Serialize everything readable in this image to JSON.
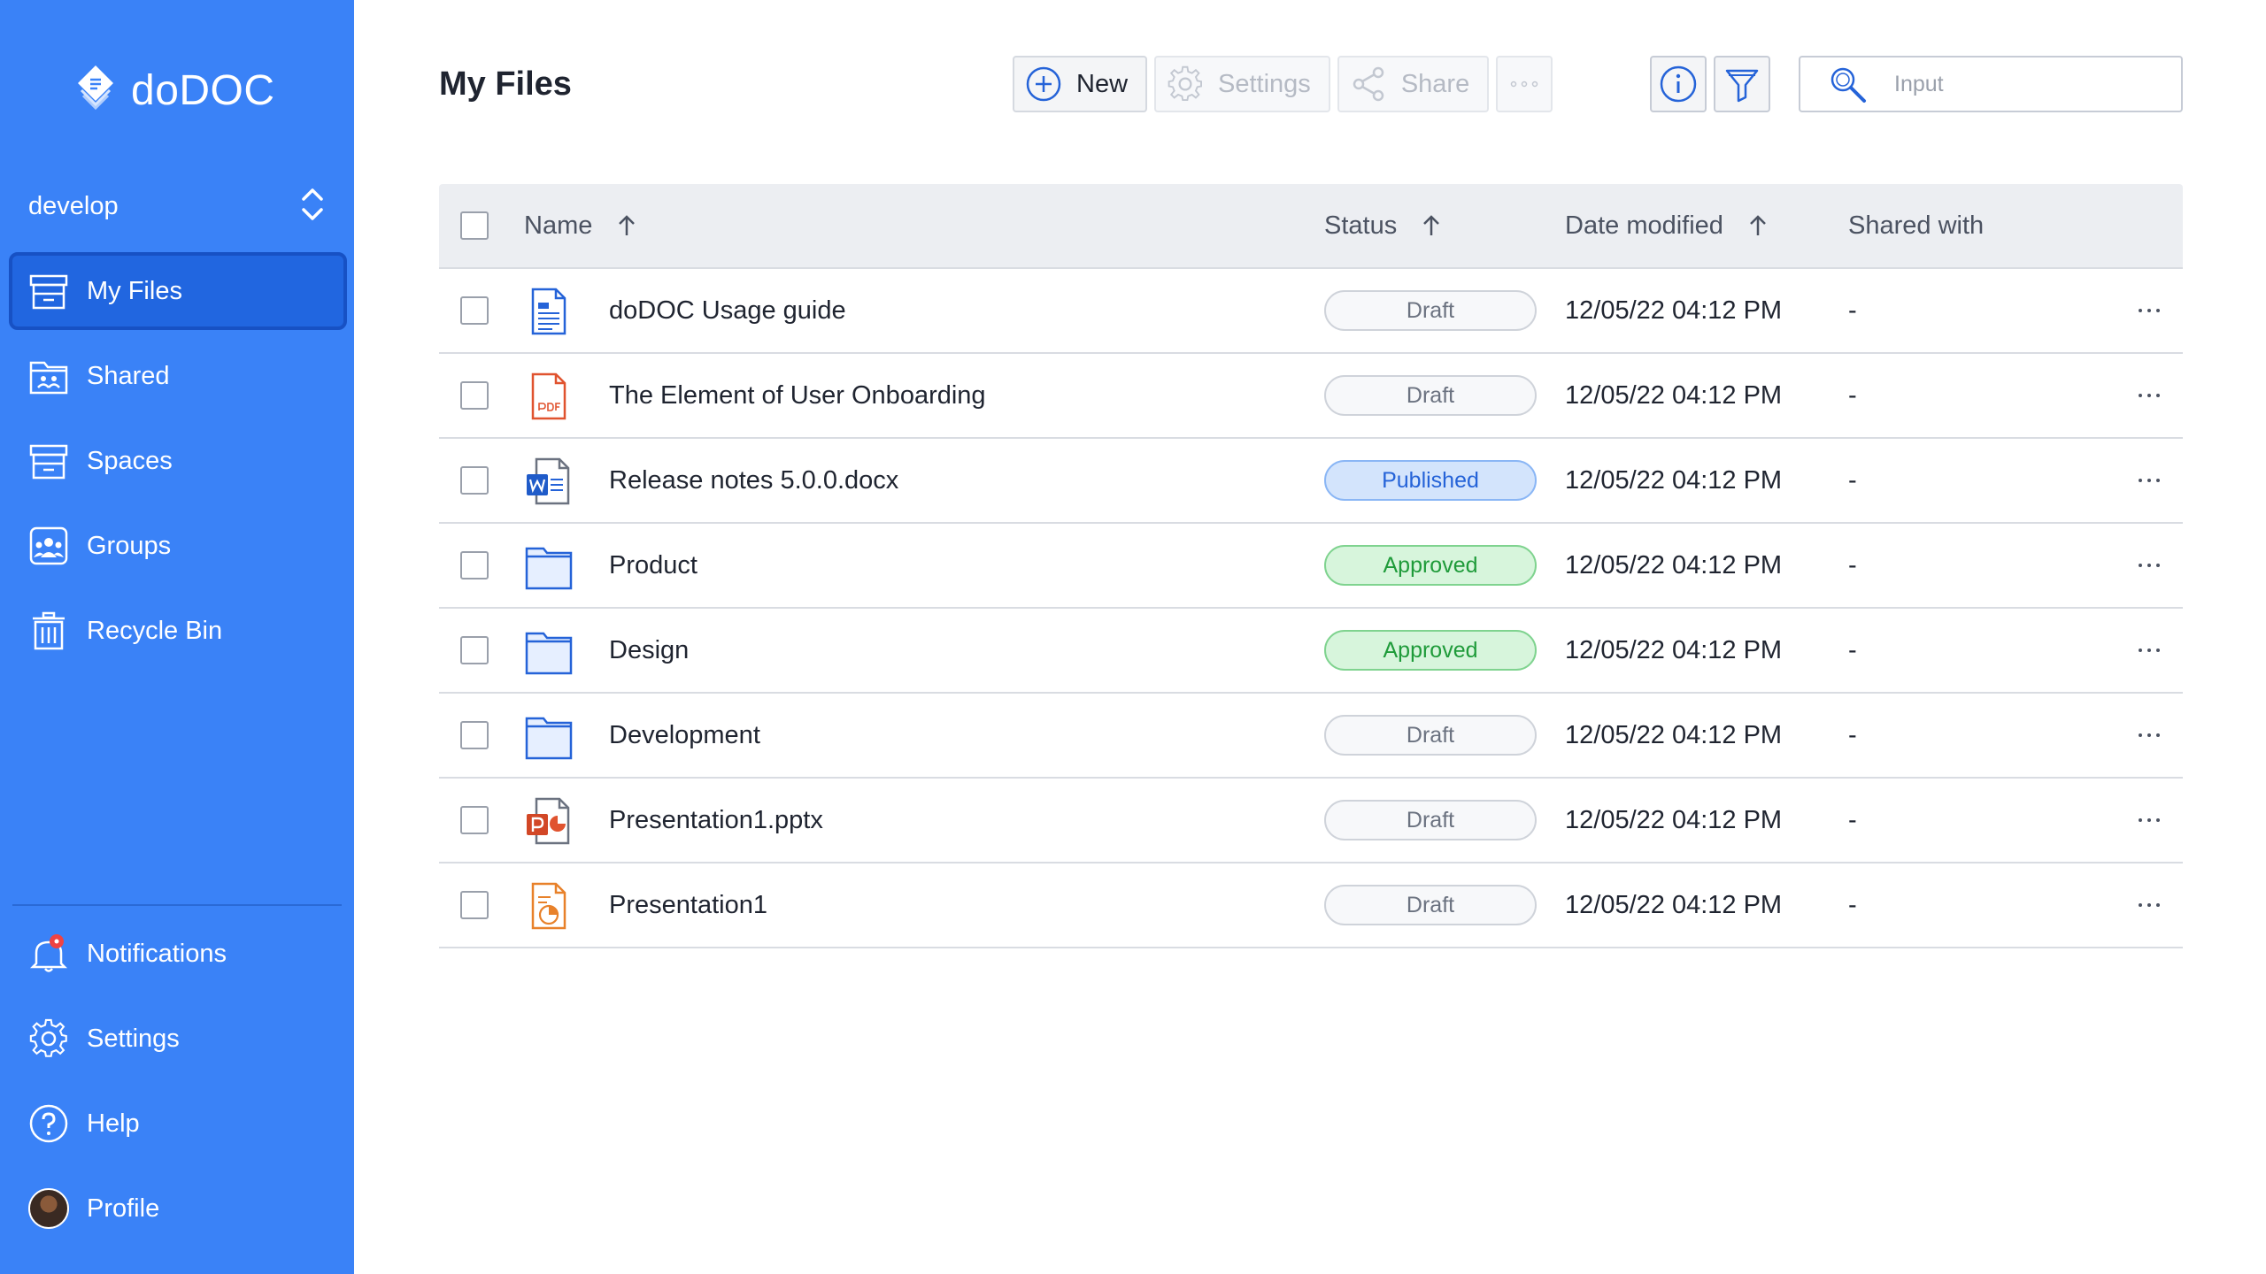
{
  "app": {
    "name": "doDOC"
  },
  "workspace": {
    "name": "develop"
  },
  "sidebar": {
    "items": [
      {
        "label": "My Files",
        "icon": "archive-box-icon",
        "active": true
      },
      {
        "label": "Shared",
        "icon": "shared-folder-icon",
        "active": false
      },
      {
        "label": "Spaces",
        "icon": "spaces-box-icon",
        "active": false
      },
      {
        "label": "Groups",
        "icon": "groups-icon",
        "active": false
      },
      {
        "label": "Recycle Bin",
        "icon": "trash-icon",
        "active": false
      }
    ],
    "bottom": [
      {
        "label": "Notifications",
        "icon": "bell-icon",
        "has_badge": true
      },
      {
        "label": "Settings",
        "icon": "gear-icon"
      },
      {
        "label": "Help",
        "icon": "help-icon"
      },
      {
        "label": "Profile",
        "icon": "avatar"
      }
    ]
  },
  "header": {
    "title": "My Files",
    "toolbar": {
      "new_label": "New",
      "settings_label": "Settings",
      "share_label": "Share"
    },
    "search": {
      "placeholder": "Input",
      "value": ""
    }
  },
  "table": {
    "columns": {
      "name": "Name",
      "status": "Status",
      "date": "Date modified",
      "shared": "Shared with"
    },
    "rows": [
      {
        "name": "doDOC Usage guide",
        "type": "document",
        "status": "Draft",
        "date": "12/05/22 04:12 PM",
        "shared": "-"
      },
      {
        "name": "The Element of User Onboarding",
        "type": "pdf",
        "status": "Draft",
        "date": "12/05/22 04:12 PM",
        "shared": "-"
      },
      {
        "name": "Release notes 5.0.0.docx",
        "type": "word",
        "status": "Published",
        "date": "12/05/22 04:12 PM",
        "shared": "-"
      },
      {
        "name": "Product",
        "type": "folder",
        "status": "Approved",
        "date": "12/05/22 04:12 PM",
        "shared": "-"
      },
      {
        "name": "Design",
        "type": "folder",
        "status": "Approved",
        "date": "12/05/22 04:12 PM",
        "shared": "-"
      },
      {
        "name": "Development",
        "type": "folder",
        "status": "Draft",
        "date": "12/05/22 04:12 PM",
        "shared": "-"
      },
      {
        "name": "Presentation1.pptx",
        "type": "powerpoint",
        "status": "Draft",
        "date": "12/05/22 04:12 PM",
        "shared": "-"
      },
      {
        "name": "Presentation1",
        "type": "presentation",
        "status": "Draft",
        "date": "12/05/22 04:12 PM",
        "shared": "-"
      }
    ]
  },
  "colors": {
    "sidebar_bg": "#3a82f7",
    "active_item_bg": "#2166e0",
    "published": "#2563d8",
    "approved": "#1f9b3a",
    "draft": "#6b7280"
  }
}
